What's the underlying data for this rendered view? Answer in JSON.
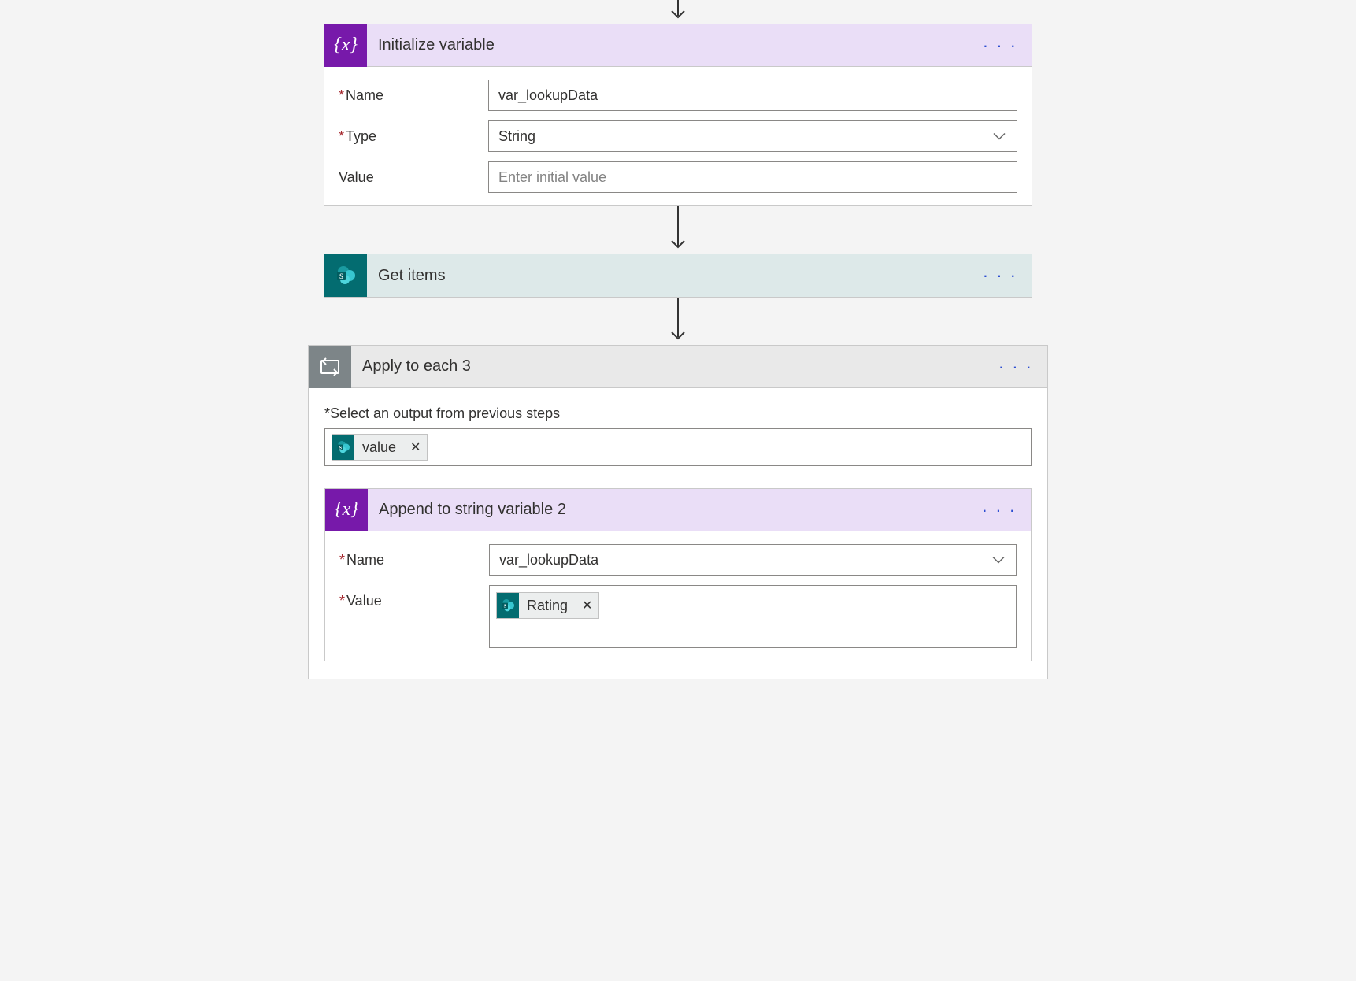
{
  "connector_arrow": "↓",
  "actions": {
    "init_var": {
      "title": "Initialize variable",
      "menu": "· · ·",
      "fields": {
        "name_label": "Name",
        "name_value": "var_lookupData",
        "type_label": "Type",
        "type_value": "String",
        "value_label": "Value",
        "value_placeholder": "Enter initial value"
      }
    },
    "get_items": {
      "title": "Get items",
      "menu": "· · ·"
    },
    "apply_each": {
      "title": "Apply to each 3",
      "menu": "· · ·",
      "select_label": "Select an output from previous steps",
      "token_value": "value",
      "inner": {
        "title": "Append to string variable 2",
        "menu": "· · ·",
        "fields": {
          "name_label": "Name",
          "name_value": "var_lookupData",
          "value_label": "Value",
          "token_rating": "Rating"
        }
      }
    }
  }
}
